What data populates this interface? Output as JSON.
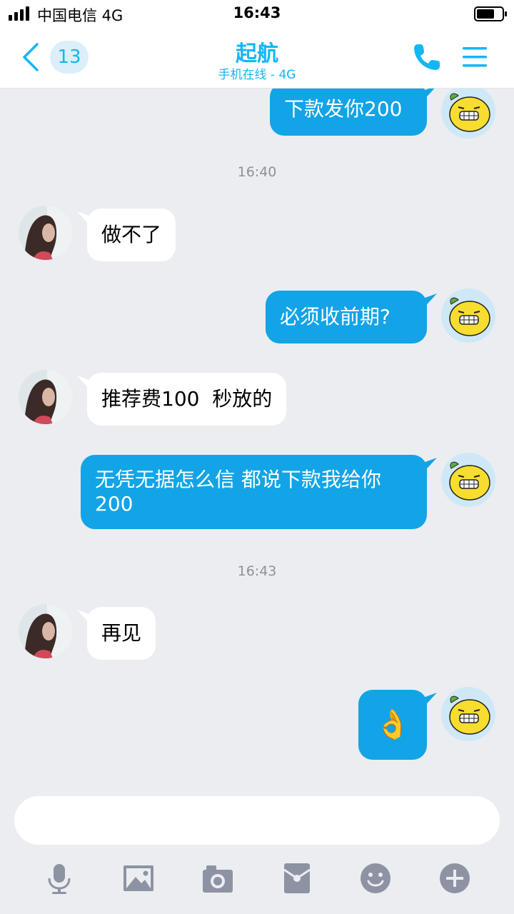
{
  "status_bar": {
    "carrier": "中国电信  4G",
    "time": "16:43"
  },
  "header": {
    "unread_count": "13",
    "contact_name": "起航",
    "contact_status": "手机在线 - 4G"
  },
  "messages": [
    {
      "side": "out",
      "text": "下款发你200"
    },
    {
      "type": "time",
      "text": "16:40"
    },
    {
      "side": "in",
      "text": "做不了"
    },
    {
      "side": "out",
      "text": "必须收前期?"
    },
    {
      "side": "in",
      "text": "推荐费100  秒放的"
    },
    {
      "side": "out",
      "text": "无凭无据怎么信 都说下款我给你200"
    },
    {
      "type": "time",
      "text": "16:43"
    },
    {
      "side": "in",
      "text": "再见"
    },
    {
      "side": "out",
      "text": "👌",
      "kind": "emoji"
    }
  ],
  "input": {
    "placeholder": ""
  },
  "toolbar": [
    "microphone-icon",
    "image-icon",
    "camera-icon",
    "red-packet-icon",
    "emoji-icon",
    "plus-icon"
  ],
  "colors": {
    "accent": "#12b7f5",
    "outgoing_bubble": "#12a4e6",
    "background": "#ebedf1"
  }
}
